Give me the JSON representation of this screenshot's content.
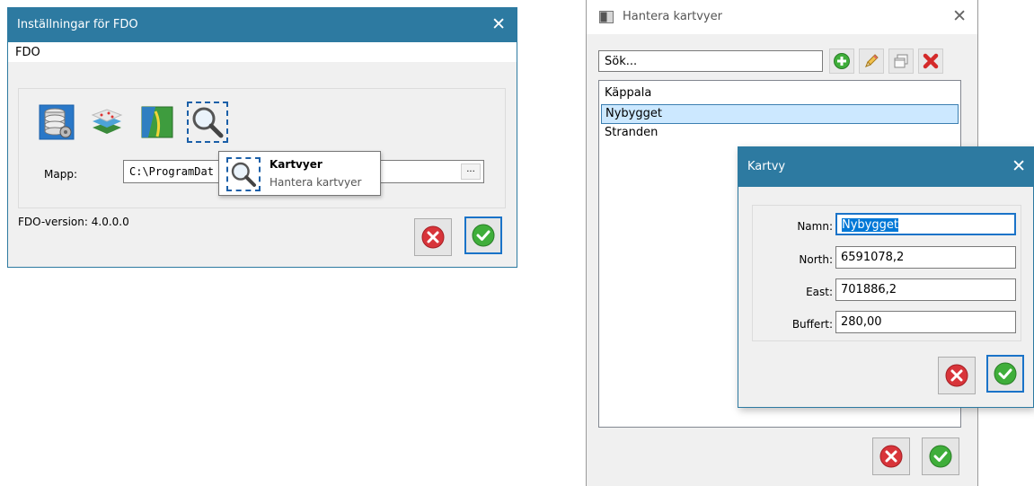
{
  "fdo_window": {
    "title": "Inställningar för FDO",
    "close_glyph": "✕",
    "menu": [
      "FDO"
    ],
    "tools": [
      {
        "icon": "database-icon"
      },
      {
        "icon": "map-layers-icon"
      },
      {
        "icon": "map-icon"
      },
      {
        "icon": "magnifier-icon",
        "selected": true
      }
    ],
    "folder_label": "Mapp:",
    "folder_value": "C:\\ProgramDat",
    "browse_label": "...",
    "tooltip": {
      "title": "Kartvyer",
      "description": "Hantera kartvyer"
    },
    "version_text": "FDO-version: 4.0.0.0"
  },
  "manage_window": {
    "title": "Hantera kartvyer",
    "close_glyph": "✕",
    "search_placeholder": "Sök...",
    "toolbar": [
      {
        "icon": "add-icon"
      },
      {
        "icon": "edit-pencil-icon"
      },
      {
        "icon": "copy-icon"
      },
      {
        "icon": "delete-icon"
      }
    ],
    "items": [
      {
        "label": "Käppala",
        "selected": false
      },
      {
        "label": "Nybygget",
        "selected": true
      },
      {
        "label": "Stranden",
        "selected": false
      }
    ]
  },
  "kartvy_dialog": {
    "title": "Kartvy",
    "close_glyph": "✕",
    "fields": [
      {
        "label": "Namn:",
        "value": "Nybygget"
      },
      {
        "label": "North:",
        "value": "6591078,2"
      },
      {
        "label": "East:",
        "value": "701886,2"
      },
      {
        "label": "Buffert:",
        "value": "280,00"
      }
    ]
  },
  "colors": {
    "titlebar_accent": "#2d7aa1",
    "selection": "#cce8ff",
    "cancel_red": "#d8343a",
    "ok_green": "#3fae3a"
  }
}
